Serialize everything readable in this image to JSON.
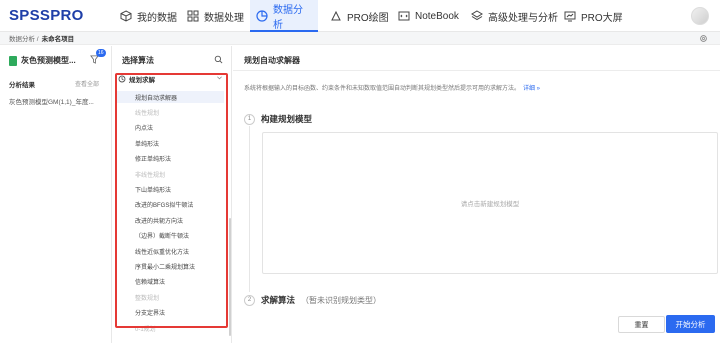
{
  "app": {
    "logo": "SPSSPRO"
  },
  "nav": {
    "items": [
      {
        "label": "我的数据",
        "icon": "cube-icon"
      },
      {
        "label": "数据处理",
        "icon": "grid-icon"
      },
      {
        "label": "数据分析",
        "icon": "pie-chart-icon",
        "active": true
      },
      {
        "label": "PRO绘图",
        "icon": "shape-icon"
      },
      {
        "label": "NoteBook",
        "icon": "code-icon"
      },
      {
        "label": "高级处理与分析",
        "icon": "layers-icon"
      },
      {
        "label": "PRO大屏",
        "icon": "monitor-icon"
      }
    ]
  },
  "breadcrumb": {
    "root": "数据分析 /",
    "current": "未命名项目"
  },
  "left": {
    "model_title": "灰色预测模型...",
    "badge": "16",
    "results_title": "分析结果",
    "results_all": "查看全部",
    "result_item": "灰色预测模型GM(1,1)_年度..."
  },
  "algorithms": {
    "title": "选择算法",
    "group": "规划求解",
    "rows": [
      {
        "label": "规划自动求解器",
        "kind": "item",
        "selected": true
      },
      {
        "label": "线性规划",
        "kind": "cat"
      },
      {
        "label": "内点法",
        "kind": "item"
      },
      {
        "label": "单纯形法",
        "kind": "item"
      },
      {
        "label": "修正单纯形法",
        "kind": "item"
      },
      {
        "label": "非线性规划",
        "kind": "cat"
      },
      {
        "label": "下山单纯形法",
        "kind": "item"
      },
      {
        "label": "改进的BFGS拟牛顿法",
        "kind": "item"
      },
      {
        "label": "改进的共轭方向法",
        "kind": "item"
      },
      {
        "label": "（边界）截断牛顿法",
        "kind": "item"
      },
      {
        "label": "线性近似重优化方法",
        "kind": "item"
      },
      {
        "label": "序贯最小二乘规划算法",
        "kind": "item"
      },
      {
        "label": "信赖域算法",
        "kind": "item"
      },
      {
        "label": "整数规划",
        "kind": "cat"
      },
      {
        "label": "分支定界法",
        "kind": "item"
      },
      {
        "label": "0-1规划",
        "kind": "cat"
      }
    ]
  },
  "main": {
    "title": "规划自动求解器",
    "description": "系统将根据输入的目标函数、约束条件和未知数取值范围自动判断其规划类型然后提示可用的求解方法。",
    "detail_link": "详细 »",
    "step1_num": "1",
    "step1_title": "构建规划模型",
    "dropbox_hint": "请点击新建规划模型",
    "step2_num": "2",
    "step2_title": "求解算法",
    "step2_sub": "（暂未识别规划类型）",
    "reset_label": "重置",
    "start_label": "开始分析"
  },
  "colors": {
    "accent": "#2b6af0",
    "highlight_box": "#e53935",
    "sheet_icon": "#2eaa5c"
  }
}
